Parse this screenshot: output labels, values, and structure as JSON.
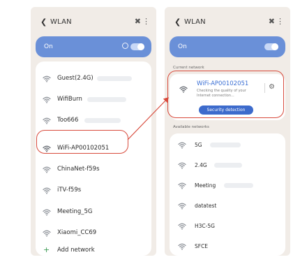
{
  "colors": {
    "panel": "#f1ece7",
    "toggle_bar": "#6a90d8",
    "accent_blue": "#3b6fd4",
    "button_blue": "#3d6bcc",
    "highlight_red": "#d84a3c",
    "add_green": "#3a9a52"
  },
  "icons": {
    "back": "chevron-left-icon",
    "scan": "x-scan-icon",
    "more": "more-vertical-icon",
    "wifi": "wifi-icon",
    "settings": "gear-icon",
    "add": "plus-icon"
  },
  "left_screen": {
    "header": {
      "title": "WLAN"
    },
    "toggle": {
      "label": "On",
      "on": true
    },
    "networks": [
      {
        "name": "Guest(2.4G)"
      },
      {
        "name": "WifiBurn"
      },
      {
        "name": "Too666"
      },
      {
        "name": "WiFi-AP00102051",
        "highlighted": true
      },
      {
        "name": "ChinaNet-f59s"
      },
      {
        "name": "iTV-f59s"
      },
      {
        "name": "Meeting_5G"
      },
      {
        "name": "Xiaomi_CC69"
      }
    ],
    "add_network_label": "Add network"
  },
  "right_screen": {
    "header": {
      "title": "WLAN"
    },
    "toggle": {
      "label": "On",
      "on": true
    },
    "current_network_label": "Current network",
    "current_network": {
      "name": "WiFi-AP00102051",
      "status": "Checking the quality of your Internet connection...",
      "button_label": "Security detection"
    },
    "available_networks_label": "Available networks",
    "available_networks": [
      {
        "name": "5G"
      },
      {
        "name": "2.4G"
      },
      {
        "name": "Meeting"
      },
      {
        "name": "datatest"
      },
      {
        "name": "H3C-5G"
      },
      {
        "name": "SFCE"
      }
    ]
  }
}
